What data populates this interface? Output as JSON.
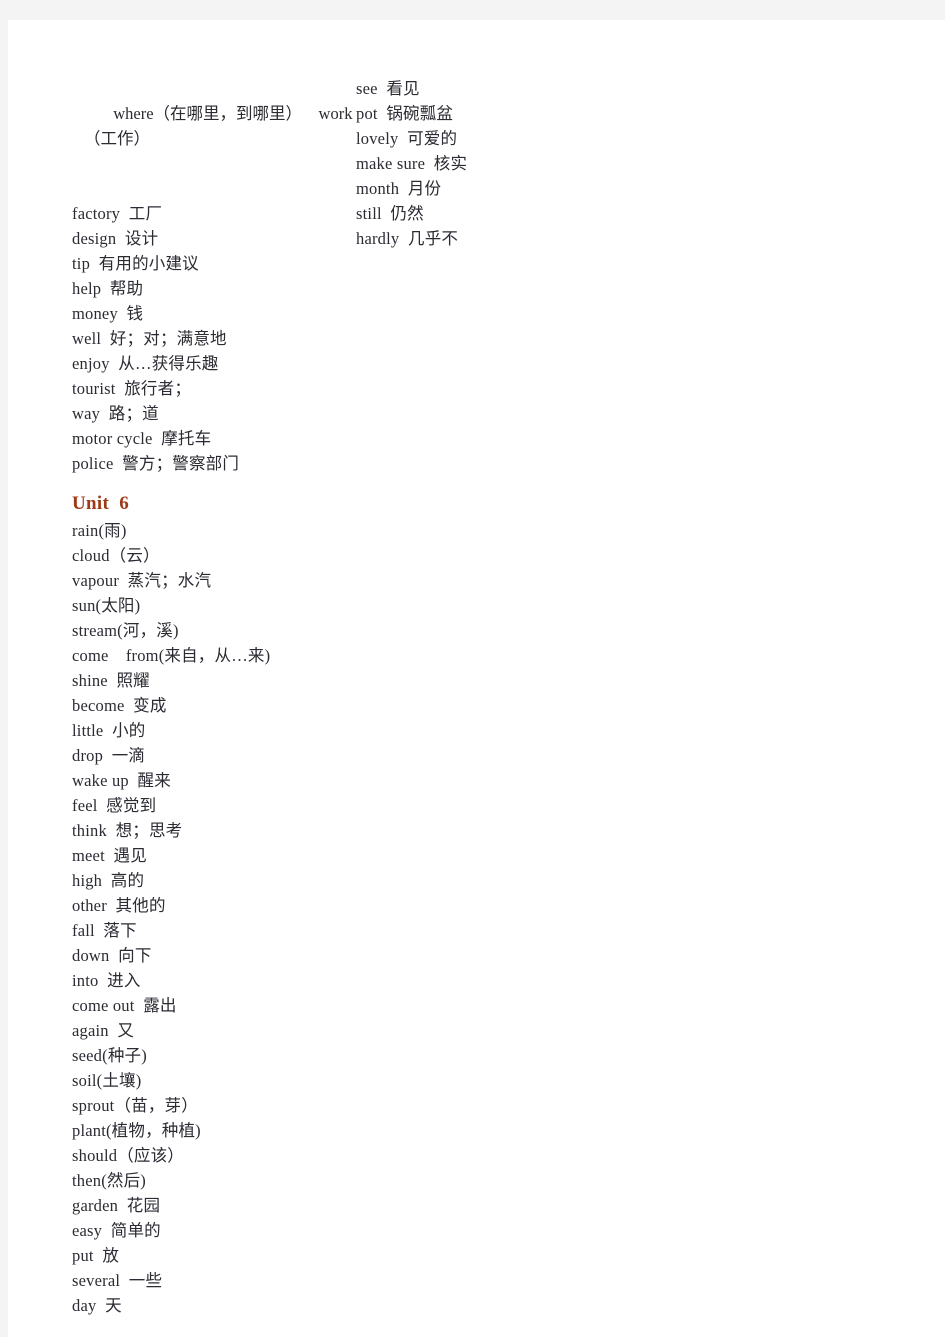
{
  "page": {
    "background_color": "#ffffff",
    "scan_band_color": "#f4f4f4",
    "text_color": "#2b2b33",
    "heading_color": "#9e3a15"
  },
  "unit5_tail": {
    "first_entry": {
      "line1": "where（在哪里，到哪里）    work",
      "line2": "（工作）"
    },
    "left_column": [
      "factory  工厂",
      "design  设计",
      "tip  有用的小建议",
      "help  帮助",
      "money  钱",
      "well  好；对；满意地",
      "enjoy  从…获得乐趣",
      "tourist  旅行者；",
      "way  路；道",
      "motor cycle  摩托车",
      "police  警方；警察部门"
    ],
    "right_column": [
      "see  看见",
      "pot  锅碗瓢盆",
      "lovely  可爱的",
      "make sure  核实",
      "month  月份",
      "still  仍然",
      "hardly  几乎不"
    ]
  },
  "unit6": {
    "heading": "Unit  6",
    "entries": [
      "rain(雨)",
      "cloud（云）",
      "vapour  蒸汽；水汽",
      "sun(太阳)",
      "stream(河，溪)",
      "come    from(来自，从…来)",
      "shine  照耀",
      "become  变成",
      "little  小的",
      "drop  一滴",
      "wake up  醒来",
      "feel  感觉到",
      "think  想；思考",
      "meet  遇见",
      "high  高的",
      "other  其他的",
      "fall  落下",
      "down  向下",
      "into  进入",
      "come out  露出",
      "again  又",
      "seed(种子)",
      "soil(土壤)",
      "sprout（苗，芽）",
      "plant(植物，种植)",
      "should（应该）",
      "then(然后)",
      "garden  花园",
      "easy  简单的",
      "put  放",
      "several  一些",
      "day  天"
    ]
  }
}
